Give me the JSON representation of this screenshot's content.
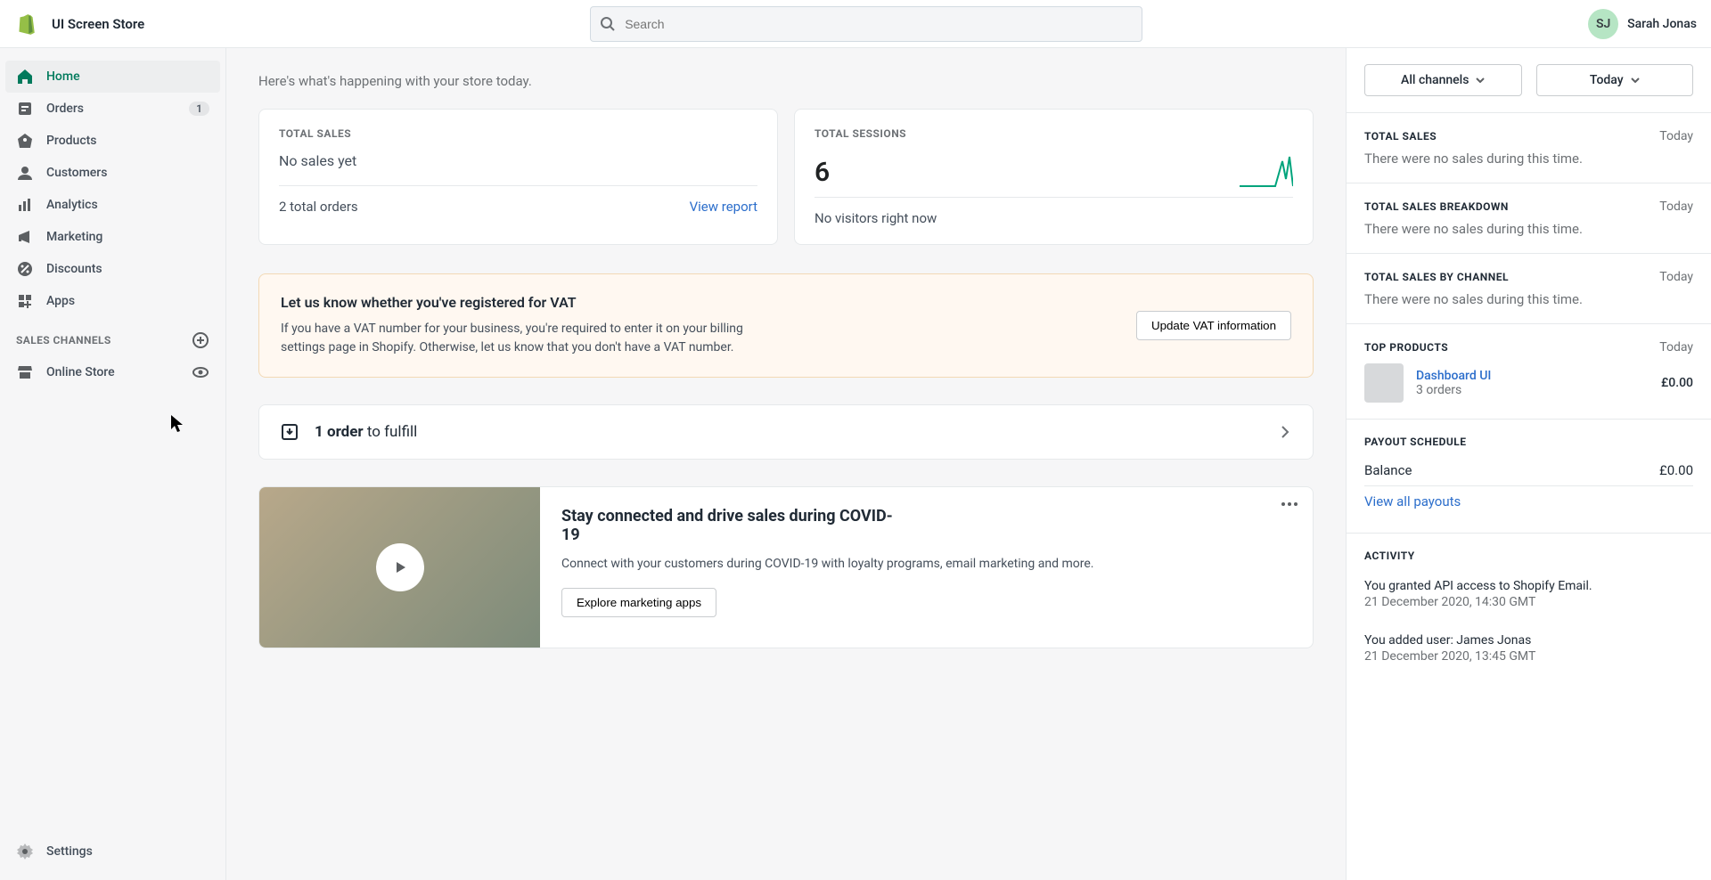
{
  "header": {
    "store_name": "UI Screen Store",
    "search_placeholder": "Search",
    "user_initials": "SJ",
    "user_name": "Sarah Jonas"
  },
  "sidebar": {
    "items": [
      {
        "label": "Home"
      },
      {
        "label": "Orders",
        "badge": "1"
      },
      {
        "label": "Products"
      },
      {
        "label": "Customers"
      },
      {
        "label": "Analytics"
      },
      {
        "label": "Marketing"
      },
      {
        "label": "Discounts"
      },
      {
        "label": "Apps"
      }
    ],
    "section_label": "SALES CHANNELS",
    "channel_label": "Online Store",
    "settings_label": "Settings"
  },
  "main": {
    "subtitle": "Here's what's happening with your store today.",
    "total_sales": {
      "label": "TOTAL SALES",
      "value": "No sales yet",
      "orders": "2 total orders",
      "link": "View report"
    },
    "sessions": {
      "label": "TOTAL SESSIONS",
      "value": "6",
      "footer": "No visitors right now"
    },
    "banner": {
      "title": "Let us know whether you've registered for VAT",
      "body": "If you have a VAT number for your business, you're required to enter it on your billing settings page in Shopify. Otherwise, let us know that you don't have a VAT number.",
      "button": "Update VAT information"
    },
    "fulfill": {
      "bold": "1 order",
      "rest": " to fulfill"
    },
    "promo": {
      "title": "Stay connected and drive sales during COVID-19",
      "body": "Connect with your customers during COVID-19 with loyalty programs, email marketing and more.",
      "button": "Explore marketing apps"
    }
  },
  "aside": {
    "channel_select": "All channels",
    "date_select": "Today",
    "blocks": [
      {
        "label": "TOTAL SALES",
        "when": "Today",
        "body": "There were no sales during this time."
      },
      {
        "label": "TOTAL SALES BREAKDOWN",
        "when": "Today",
        "body": "There were no sales during this time."
      },
      {
        "label": "TOTAL SALES BY CHANNEL",
        "when": "Today",
        "body": "There were no sales during this time."
      }
    ],
    "top_products": {
      "label": "TOP PRODUCTS",
      "when": "Today",
      "name": "Dashboard UI",
      "sub": "3 orders",
      "amount": "£0.00"
    },
    "payout": {
      "label": "PAYOUT SCHEDULE",
      "balance_label": "Balance",
      "balance_amount": "£0.00",
      "link": "View all payouts"
    },
    "activity": {
      "label": "ACTIVITY",
      "items": [
        {
          "text": "You granted API access to Shopify Email.",
          "time": "21 December 2020, 14:30 GMT"
        },
        {
          "text": "You added user: James Jonas",
          "time": "21 December 2020, 13:45 GMT"
        }
      ]
    }
  }
}
